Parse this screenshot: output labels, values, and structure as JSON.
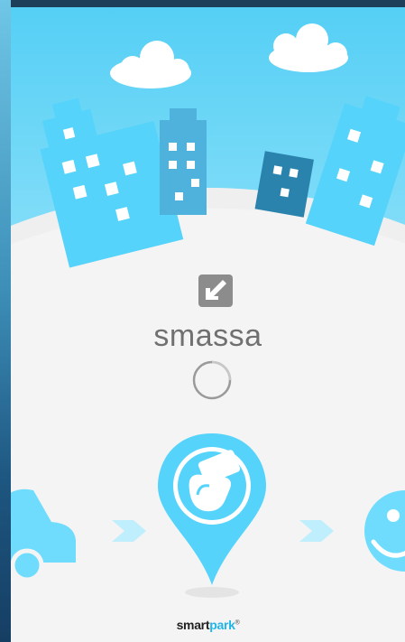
{
  "app": {
    "logo_text": "smassa",
    "footer_brand_part1": "smart",
    "footer_brand_part2": "park",
    "footer_brand_mark": "®",
    "loading": true
  },
  "colors": {
    "sky_top": "#55cff5",
    "building_light": "#55d3fb",
    "building_mid": "#4fb2dd",
    "building_dark": "#2a83ad",
    "logo_gray": "#8c8c8c",
    "footer_accent": "#22b5e8"
  },
  "icons": [
    "cloud",
    "building",
    "arrow-down-left",
    "loading-spinner",
    "car",
    "chevron-right",
    "map-pin-hand-card",
    "smiley-face"
  ]
}
